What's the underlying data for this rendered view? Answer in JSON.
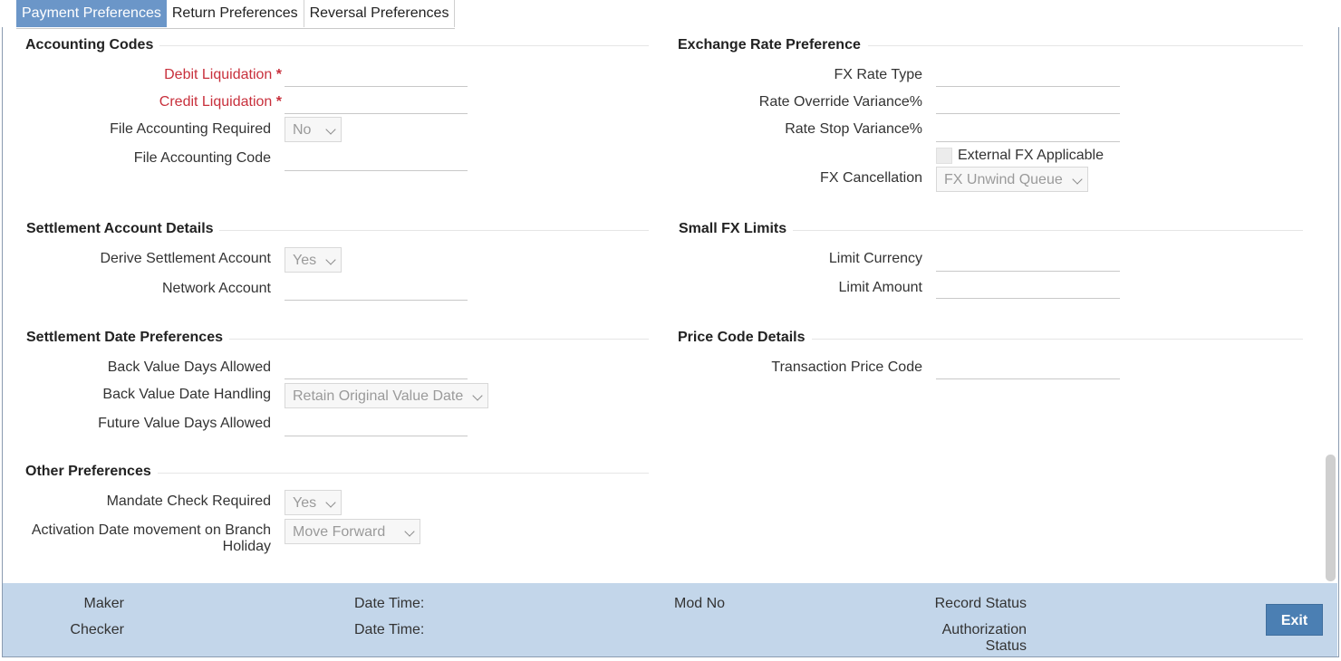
{
  "tabs": [
    "Payment Preferences",
    "Return Preferences",
    "Reversal Preferences"
  ],
  "accounting_codes": {
    "title": "Accounting Codes",
    "debit_liquidation": "Debit Liquidation",
    "credit_liquidation": "Credit Liquidation",
    "required_star": "*",
    "file_accounting_required": "File Accounting Required",
    "file_accounting_required_value": "No",
    "file_accounting_code": "File Accounting Code"
  },
  "exchange_rate": {
    "title": "Exchange Rate Preference",
    "fx_rate_type": "FX Rate Type",
    "rate_override_variance": "Rate Override Variance%",
    "rate_stop_variance": "Rate Stop Variance%",
    "external_fx_applicable": "External FX Applicable",
    "fx_cancellation": "FX Cancellation",
    "fx_cancellation_value": "FX Unwind Queue"
  },
  "settlement_account": {
    "title": "Settlement Account Details",
    "derive_settlement_account": "Derive Settlement Account",
    "derive_settlement_account_value": "Yes",
    "network_account": "Network Account"
  },
  "small_fx": {
    "title": "Small FX Limits",
    "limit_currency": "Limit Currency",
    "limit_amount": "Limit Amount"
  },
  "settlement_date": {
    "title": "Settlement Date Preferences",
    "back_value_days_allowed": "Back Value Days Allowed",
    "back_value_date_handling": "Back Value Date Handling",
    "back_value_date_handling_value": "Retain Original Value Date",
    "future_value_days_allowed": "Future Value Days Allowed"
  },
  "price_code": {
    "title": "Price Code Details",
    "transaction_price_code": "Transaction Price Code"
  },
  "other_preferences": {
    "title": "Other Preferences",
    "mandate_check_required": "Mandate Check Required",
    "mandate_check_required_value": "Yes",
    "activation_date_line1": "Activation Date movement on Branch",
    "activation_date_line2": "Holiday",
    "activation_date_value": "Move Forward"
  },
  "footer": {
    "maker": "Maker",
    "checker": "Checker",
    "date_time_1": "Date Time:",
    "date_time_2": "Date Time:",
    "mod_no": "Mod No",
    "record_status": "Record Status",
    "authorization_line1": "Authorization",
    "authorization_line2": "Status",
    "exit": "Exit"
  }
}
